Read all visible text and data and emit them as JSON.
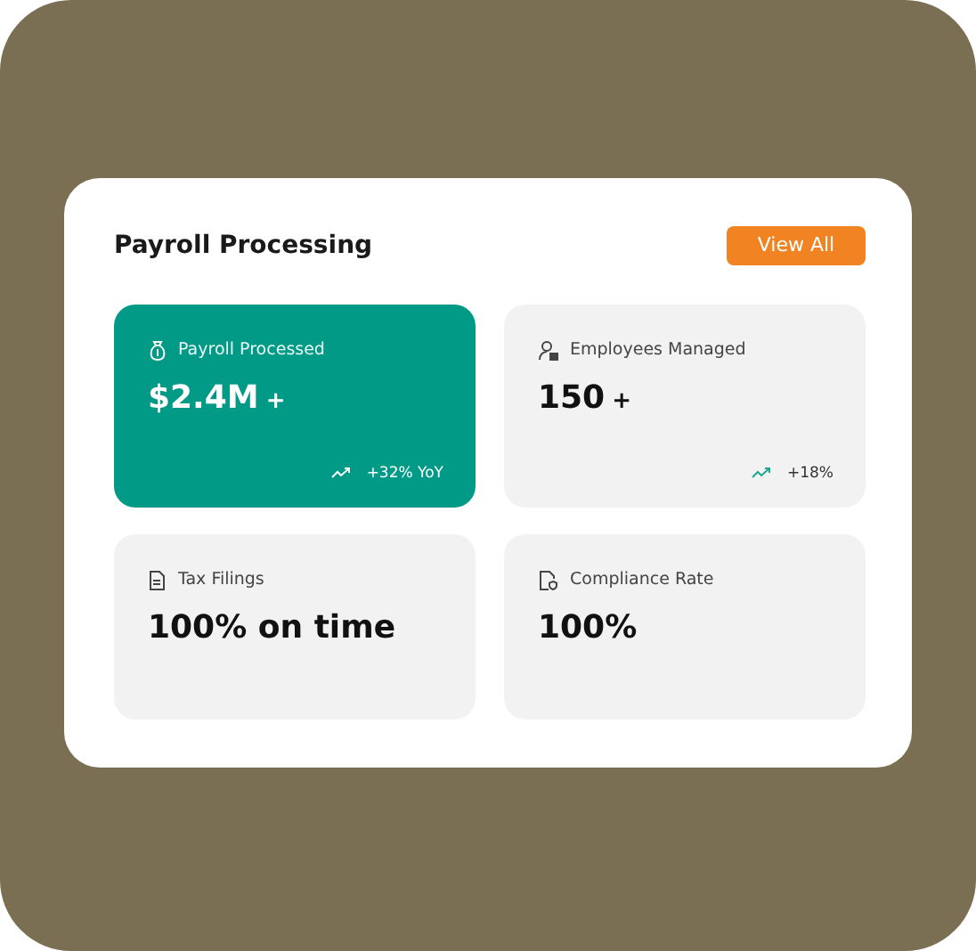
{
  "card": {
    "title": "Payroll Processing",
    "action": "View All"
  },
  "stats": [
    {
      "label": "Payroll Processed",
      "value": "$2.4M",
      "suffix": "+",
      "trend": "+32% YoY",
      "highlighted": true
    },
    {
      "label": "Employees Managed",
      "value": "150",
      "suffix": "+",
      "trend": "+18%",
      "highlighted": false
    },
    {
      "label": "Tax Filings",
      "value": "100% on time",
      "highlighted": false
    },
    {
      "label": "Compliance Rate",
      "value": "100%",
      "highlighted": false
    }
  ]
}
